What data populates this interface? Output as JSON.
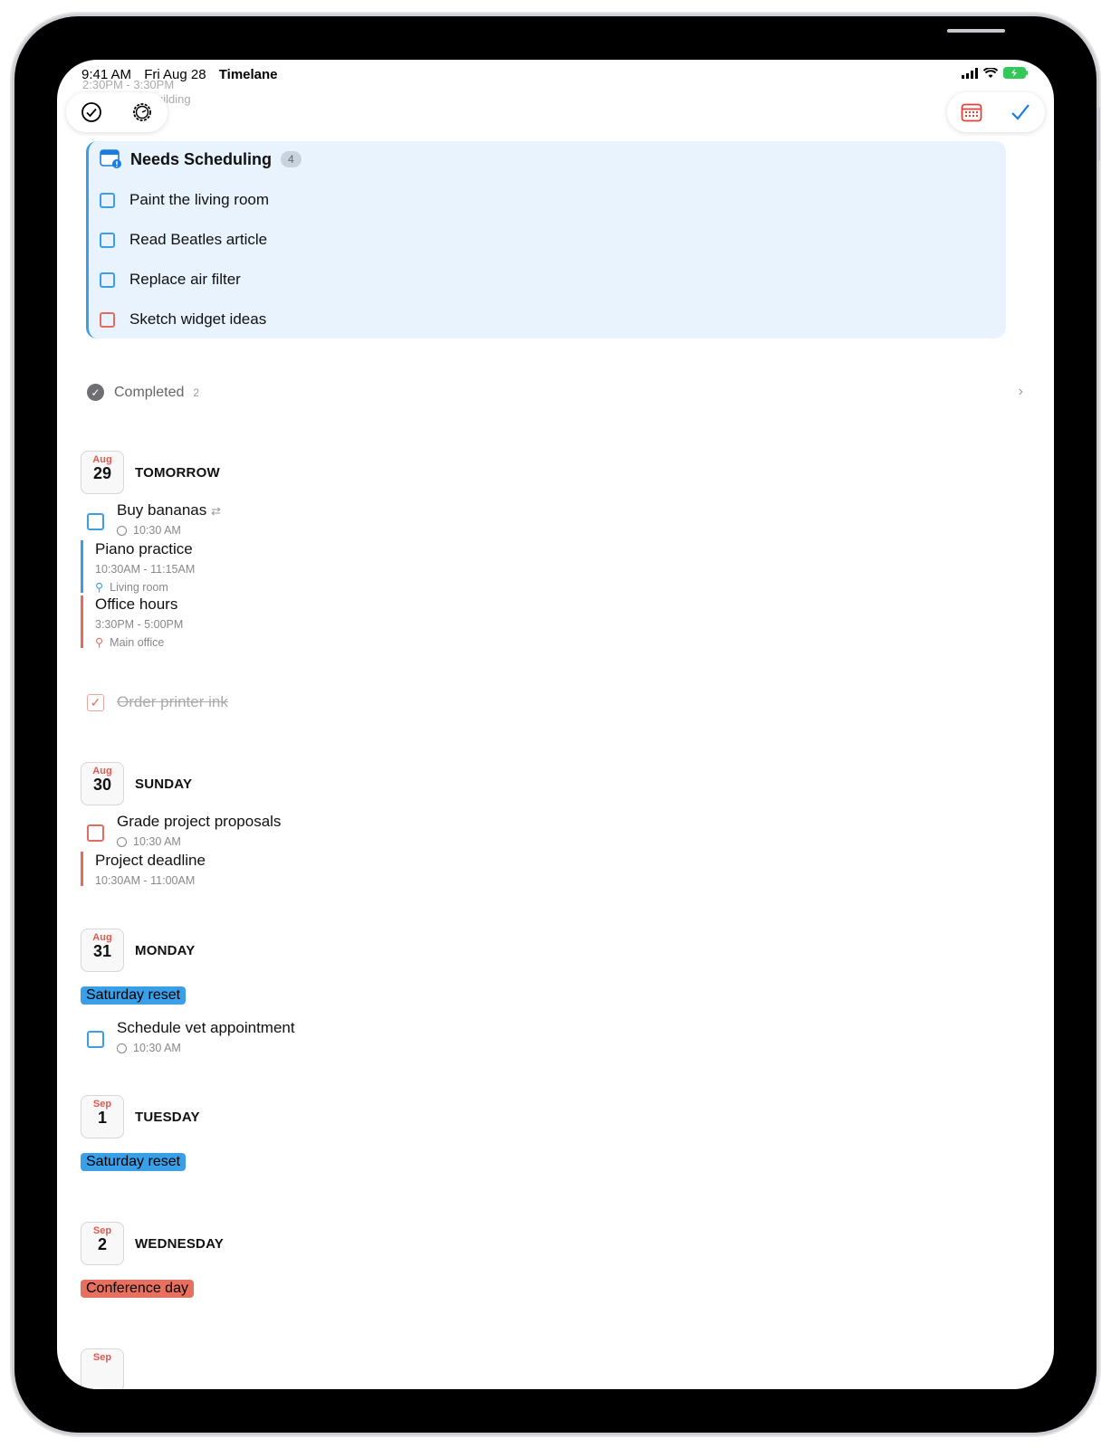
{
  "status": {
    "time": "9:41 AM",
    "date": "Fri Aug 28",
    "app": "Timelane"
  },
  "ghost": {
    "time": "2:30PM - 3:30PM",
    "location": "uilding"
  },
  "toolbar": {
    "left": [
      "checkmark-circle-icon",
      "gear-icon"
    ],
    "right": [
      "calendar-icon",
      "checkmark-icon"
    ]
  },
  "needs": {
    "title": "Needs Scheduling",
    "count": "4",
    "items": [
      {
        "label": "Paint the living room",
        "color": "#3a9fe6"
      },
      {
        "label": "Read Beatles article",
        "color": "#3a9fe6"
      },
      {
        "label": "Replace air filter",
        "color": "#3a9fe6"
      },
      {
        "label": "Sketch widget ideas",
        "color": "#e26d5f"
      }
    ]
  },
  "completed": {
    "label": "Completed",
    "count": "2"
  },
  "days": [
    {
      "month": "Aug",
      "day": "29",
      "name": "TOMORROW"
    },
    {
      "month": "Aug",
      "day": "30",
      "name": "SUNDAY"
    },
    {
      "month": "Aug",
      "day": "31",
      "name": "MONDAY"
    },
    {
      "month": "Sep",
      "day": "1",
      "name": "TUESDAY"
    },
    {
      "month": "Sep",
      "day": "2",
      "name": "WEDNESDAY"
    },
    {
      "month": "Sep",
      "day": "",
      "name": ""
    }
  ],
  "tasks": {
    "buy_bananas": {
      "title": "Buy bananas",
      "time": "10:30 AM"
    },
    "piano": {
      "title": "Piano practice",
      "time": "10:30AM - 11:15AM",
      "location": "Living room"
    },
    "office": {
      "title": "Office hours",
      "time": "3:30PM - 5:00PM",
      "location": "Main office"
    },
    "printer": {
      "title": "Order printer ink"
    },
    "grade": {
      "title": "Grade project proposals",
      "time": "10:30 AM"
    },
    "deadline": {
      "title": "Project deadline",
      "time": "10:30AM - 11:00AM"
    },
    "reset1": {
      "title": "Saturday reset"
    },
    "vet": {
      "title": "Schedule vet appointment",
      "time": "10:30 AM"
    },
    "reset2": {
      "title": "Saturday reset"
    },
    "conference": {
      "title": "Conference day"
    }
  },
  "colors": {
    "accent": "#3a9fe6",
    "red": "#e26d5f"
  }
}
